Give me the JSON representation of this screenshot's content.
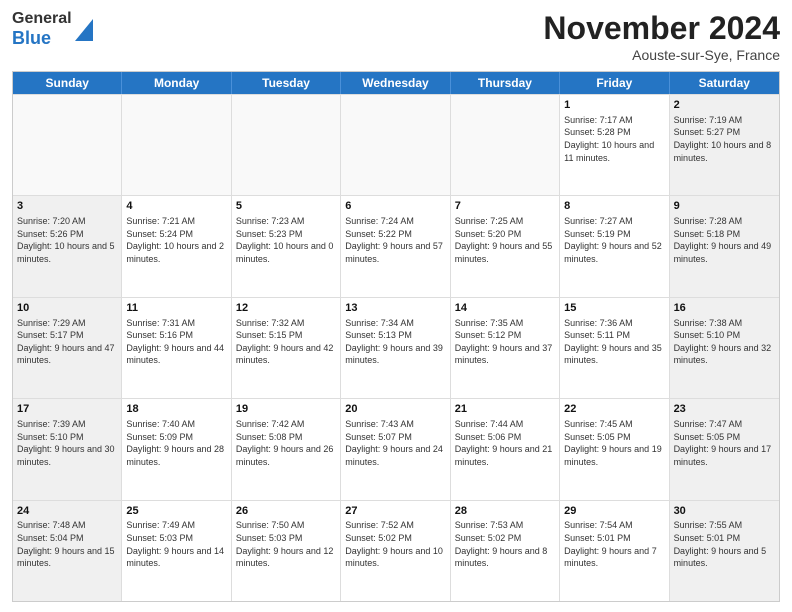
{
  "header": {
    "logo_general": "General",
    "logo_blue": "Blue",
    "month_title": "November 2024",
    "subtitle": "Aouste-sur-Sye, France"
  },
  "days_of_week": [
    "Sunday",
    "Monday",
    "Tuesday",
    "Wednesday",
    "Thursday",
    "Friday",
    "Saturday"
  ],
  "rows": [
    [
      {
        "day": "",
        "info": ""
      },
      {
        "day": "",
        "info": ""
      },
      {
        "day": "",
        "info": ""
      },
      {
        "day": "",
        "info": ""
      },
      {
        "day": "",
        "info": ""
      },
      {
        "day": "1",
        "info": "Sunrise: 7:17 AM\nSunset: 5:28 PM\nDaylight: 10 hours and 11 minutes."
      },
      {
        "day": "2",
        "info": "Sunrise: 7:19 AM\nSunset: 5:27 PM\nDaylight: 10 hours and 8 minutes."
      }
    ],
    [
      {
        "day": "3",
        "info": "Sunrise: 7:20 AM\nSunset: 5:26 PM\nDaylight: 10 hours and 5 minutes."
      },
      {
        "day": "4",
        "info": "Sunrise: 7:21 AM\nSunset: 5:24 PM\nDaylight: 10 hours and 2 minutes."
      },
      {
        "day": "5",
        "info": "Sunrise: 7:23 AM\nSunset: 5:23 PM\nDaylight: 10 hours and 0 minutes."
      },
      {
        "day": "6",
        "info": "Sunrise: 7:24 AM\nSunset: 5:22 PM\nDaylight: 9 hours and 57 minutes."
      },
      {
        "day": "7",
        "info": "Sunrise: 7:25 AM\nSunset: 5:20 PM\nDaylight: 9 hours and 55 minutes."
      },
      {
        "day": "8",
        "info": "Sunrise: 7:27 AM\nSunset: 5:19 PM\nDaylight: 9 hours and 52 minutes."
      },
      {
        "day": "9",
        "info": "Sunrise: 7:28 AM\nSunset: 5:18 PM\nDaylight: 9 hours and 49 minutes."
      }
    ],
    [
      {
        "day": "10",
        "info": "Sunrise: 7:29 AM\nSunset: 5:17 PM\nDaylight: 9 hours and 47 minutes."
      },
      {
        "day": "11",
        "info": "Sunrise: 7:31 AM\nSunset: 5:16 PM\nDaylight: 9 hours and 44 minutes."
      },
      {
        "day": "12",
        "info": "Sunrise: 7:32 AM\nSunset: 5:15 PM\nDaylight: 9 hours and 42 minutes."
      },
      {
        "day": "13",
        "info": "Sunrise: 7:34 AM\nSunset: 5:13 PM\nDaylight: 9 hours and 39 minutes."
      },
      {
        "day": "14",
        "info": "Sunrise: 7:35 AM\nSunset: 5:12 PM\nDaylight: 9 hours and 37 minutes."
      },
      {
        "day": "15",
        "info": "Sunrise: 7:36 AM\nSunset: 5:11 PM\nDaylight: 9 hours and 35 minutes."
      },
      {
        "day": "16",
        "info": "Sunrise: 7:38 AM\nSunset: 5:10 PM\nDaylight: 9 hours and 32 minutes."
      }
    ],
    [
      {
        "day": "17",
        "info": "Sunrise: 7:39 AM\nSunset: 5:10 PM\nDaylight: 9 hours and 30 minutes."
      },
      {
        "day": "18",
        "info": "Sunrise: 7:40 AM\nSunset: 5:09 PM\nDaylight: 9 hours and 28 minutes."
      },
      {
        "day": "19",
        "info": "Sunrise: 7:42 AM\nSunset: 5:08 PM\nDaylight: 9 hours and 26 minutes."
      },
      {
        "day": "20",
        "info": "Sunrise: 7:43 AM\nSunset: 5:07 PM\nDaylight: 9 hours and 24 minutes."
      },
      {
        "day": "21",
        "info": "Sunrise: 7:44 AM\nSunset: 5:06 PM\nDaylight: 9 hours and 21 minutes."
      },
      {
        "day": "22",
        "info": "Sunrise: 7:45 AM\nSunset: 5:05 PM\nDaylight: 9 hours and 19 minutes."
      },
      {
        "day": "23",
        "info": "Sunrise: 7:47 AM\nSunset: 5:05 PM\nDaylight: 9 hours and 17 minutes."
      }
    ],
    [
      {
        "day": "24",
        "info": "Sunrise: 7:48 AM\nSunset: 5:04 PM\nDaylight: 9 hours and 15 minutes."
      },
      {
        "day": "25",
        "info": "Sunrise: 7:49 AM\nSunset: 5:03 PM\nDaylight: 9 hours and 14 minutes."
      },
      {
        "day": "26",
        "info": "Sunrise: 7:50 AM\nSunset: 5:03 PM\nDaylight: 9 hours and 12 minutes."
      },
      {
        "day": "27",
        "info": "Sunrise: 7:52 AM\nSunset: 5:02 PM\nDaylight: 9 hours and 10 minutes."
      },
      {
        "day": "28",
        "info": "Sunrise: 7:53 AM\nSunset: 5:02 PM\nDaylight: 9 hours and 8 minutes."
      },
      {
        "day": "29",
        "info": "Sunrise: 7:54 AM\nSunset: 5:01 PM\nDaylight: 9 hours and 7 minutes."
      },
      {
        "day": "30",
        "info": "Sunrise: 7:55 AM\nSunset: 5:01 PM\nDaylight: 9 hours and 5 minutes."
      }
    ]
  ]
}
